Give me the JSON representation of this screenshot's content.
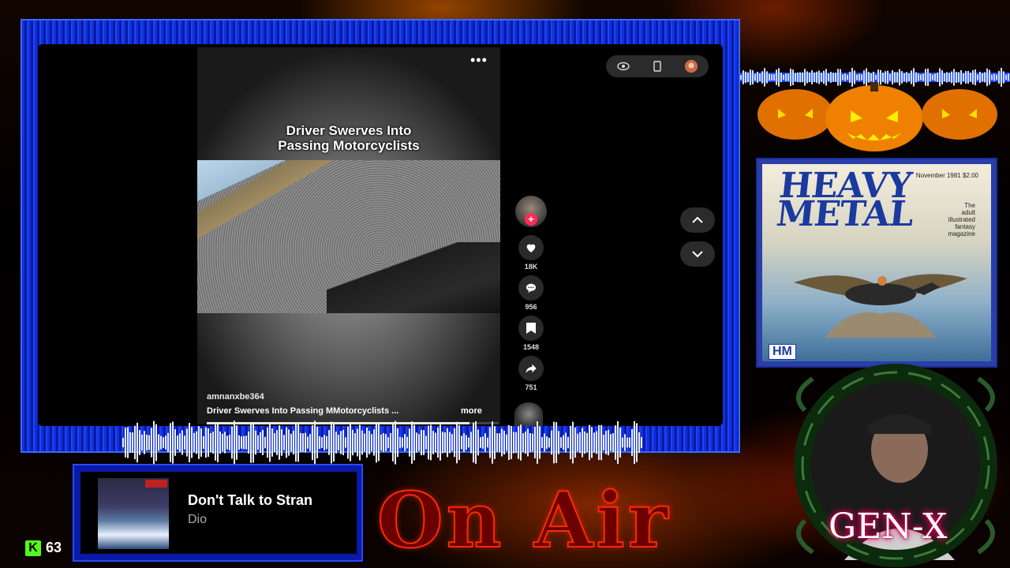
{
  "video": {
    "title_line1": "Driver Swerves Into",
    "title_line2": "Passing Motorcyclists",
    "username": "amnanxbe364",
    "caption": "Driver Swerves Into Passing MMotorcyclists ...",
    "more_label": "more",
    "menu_glyph": "•••",
    "progress_fraction": 0.9
  },
  "actions": {
    "follow_glyph": "+",
    "likes": "18K",
    "comments": "956",
    "saves": "1548",
    "shares": "751"
  },
  "now_playing": {
    "title": "Don't Talk to Stran",
    "artist": "Dio"
  },
  "kick": {
    "logo": "K",
    "viewers": "63"
  },
  "comic": {
    "title": "HEAVY METAL",
    "date": "November 1981 $2.00",
    "subtitle_lines": [
      "The",
      "adult",
      "illustrated",
      "fantasy",
      "magazine"
    ],
    "badge": "HM"
  },
  "overlay": {
    "on_air": "On Air",
    "gen_x": "GEN-X"
  },
  "colors": {
    "frame_blue": "#1230d8",
    "kick_green": "#53fc18",
    "tiktok_red": "#fe2c55"
  },
  "icons": {
    "eye": "eye-icon",
    "device": "device-icon",
    "profile": "profile-avatar-icon",
    "up": "chevron-up-icon",
    "down": "chevron-down-icon",
    "heart": "heart-icon",
    "comment": "comment-icon",
    "bookmark": "bookmark-icon",
    "share": "share-icon"
  }
}
